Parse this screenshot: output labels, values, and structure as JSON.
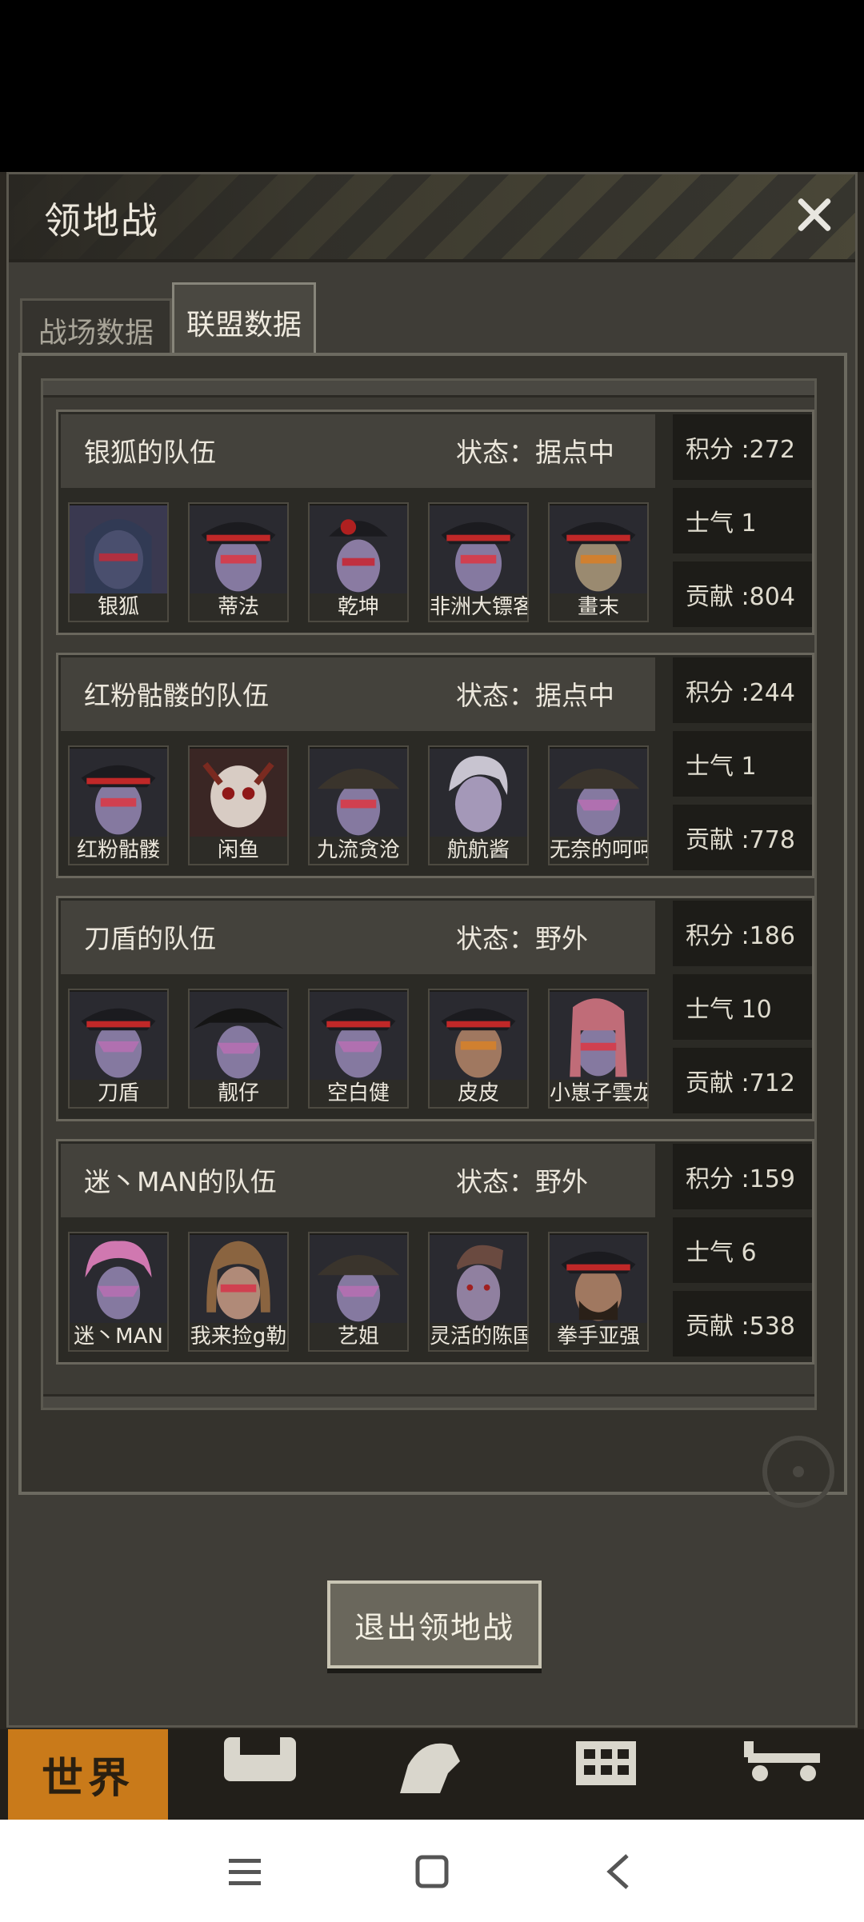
{
  "dialog": {
    "title": "领地战",
    "tabs": [
      {
        "label": "战场数据",
        "active": false
      },
      {
        "label": "联盟数据",
        "active": true
      }
    ],
    "exit_button": "退出领地战"
  },
  "teams": [
    {
      "name": "银狐的队伍",
      "status": "状态：据点中",
      "score": "积分 :272",
      "morale": "士气 1",
      "contribution": "贡献 :804",
      "members": [
        "银狐",
        "蒂法",
        "乾坤",
        "非洲大镖客",
        "畫末"
      ]
    },
    {
      "name": "红粉骷髅的队伍",
      "status": "状态：据点中",
      "score": "积分 :244",
      "morale": "士气 1",
      "contribution": "贡献 :778",
      "members": [
        "红粉骷髅",
        "闲鱼",
        "九流贪沧",
        "航航酱",
        "无奈的呵呵"
      ]
    },
    {
      "name": "刀盾的队伍",
      "status": "状态：野外",
      "score": "积分 :186",
      "morale": "士气 10",
      "contribution": "贡献 :712",
      "members": [
        "刀盾",
        "靓仔",
        "空白健",
        "皮皮",
        "小崽子雲龙"
      ]
    },
    {
      "name": "迷丶MAN的队伍",
      "status": "状态：野外",
      "score": "积分 :159",
      "morale": "士气 6",
      "contribution": "贡献 :538",
      "members": [
        "迷丶MAN",
        "我来捡g勒",
        "艺姐",
        "灵活的陈国",
        "拳手亚强"
      ]
    }
  ],
  "bottom_nav": {
    "world_label": "世界"
  },
  "colors": {
    "accent": "#c97a1a",
    "panel": "#3f3d37",
    "card": "#2b2a25"
  }
}
